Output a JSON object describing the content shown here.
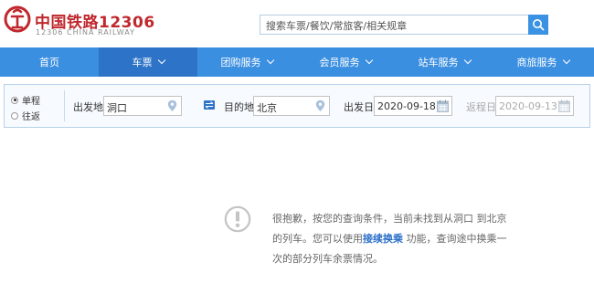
{
  "brand": {
    "name_cn": "中国铁路12306",
    "name_en": "12306 CHINA RAILWAY",
    "color": "#c0282d"
  },
  "search": {
    "placeholder": "搜索车票/餐饮/常旅客/相关规章",
    "button_icon": "search-icon"
  },
  "nav": {
    "items": [
      {
        "label": "首页",
        "has_dropdown": false,
        "active": false
      },
      {
        "label": "车票",
        "has_dropdown": true,
        "active": true
      },
      {
        "label": "团购服务",
        "has_dropdown": true,
        "active": false
      },
      {
        "label": "会员服务",
        "has_dropdown": true,
        "active": false
      },
      {
        "label": "站车服务",
        "has_dropdown": true,
        "active": false
      },
      {
        "label": "商旅服务",
        "has_dropdown": true,
        "active": false
      }
    ],
    "color": "#3b8fe0",
    "active_color": "#2d74c8"
  },
  "query": {
    "trip_types": [
      {
        "label": "单程",
        "checked": true
      },
      {
        "label": "往返",
        "checked": false
      }
    ],
    "from_label": "出发地",
    "from_value": "洞口",
    "swap_icon": "swap-icon",
    "to_label": "目的地",
    "to_value": "北京",
    "depart_label": "出发日",
    "depart_value": "2020-09-18",
    "return_label": "返程日",
    "return_value": "2020-09-13"
  },
  "message": {
    "icon": "exclamation-icon",
    "line1": "很抱歉，按您的查询条件，当前未找到从洞口 到北京",
    "line2_pre": "的列车。您可以使用",
    "line2_link": "接续换乘",
    "line2_post": " 功能，查询途中换乘一",
    "line3": "次的部分列车余票情况。"
  }
}
